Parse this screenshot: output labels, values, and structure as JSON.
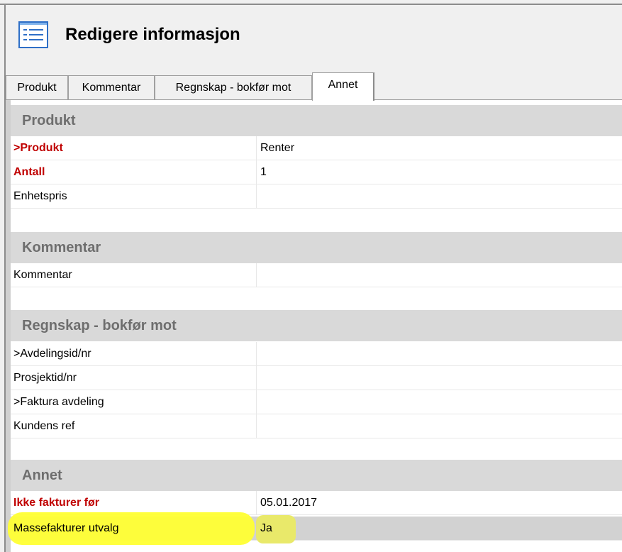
{
  "window": {
    "title": "Redigere informasjon",
    "icon": "list-form-icon"
  },
  "tabs": [
    {
      "label": "Produkt"
    },
    {
      "label": "Kommentar"
    },
    {
      "label": "Regnskap - bokfør mot"
    },
    {
      "label": "Annet",
      "active": true
    }
  ],
  "sections": [
    {
      "header": "Produkt",
      "rows": [
        {
          "label": ">Produkt",
          "value": "Renter",
          "required": true
        },
        {
          "label": "Antall",
          "value": "1",
          "required": true
        },
        {
          "label": "Enhetspris",
          "value": ""
        }
      ]
    },
    {
      "header": "Kommentar",
      "rows": [
        {
          "label": "Kommentar",
          "value": ""
        }
      ]
    },
    {
      "header": "Regnskap - bokfør mot",
      "rows": [
        {
          "label": ">Avdelingsid/nr",
          "value": ""
        },
        {
          "label": "Prosjektid/nr",
          "value": ""
        },
        {
          "label": ">Faktura avdeling",
          "value": ""
        },
        {
          "label": "Kundens ref",
          "value": ""
        }
      ]
    },
    {
      "header": "Annet",
      "rows": [
        {
          "label": "Ikke fakturer før",
          "value": "05.01.2017",
          "required": true
        },
        {
          "label": "Massefakturer utvalg",
          "value": "Ja",
          "selected": true,
          "highlighted": true
        }
      ]
    }
  ],
  "colors": {
    "required_label": "#c00000",
    "section_header_bg": "#d9d9d9",
    "section_header_text": "#6e6e6e",
    "selected_row_bg": "#d2d2d2",
    "highlight": "#ffff33"
  }
}
